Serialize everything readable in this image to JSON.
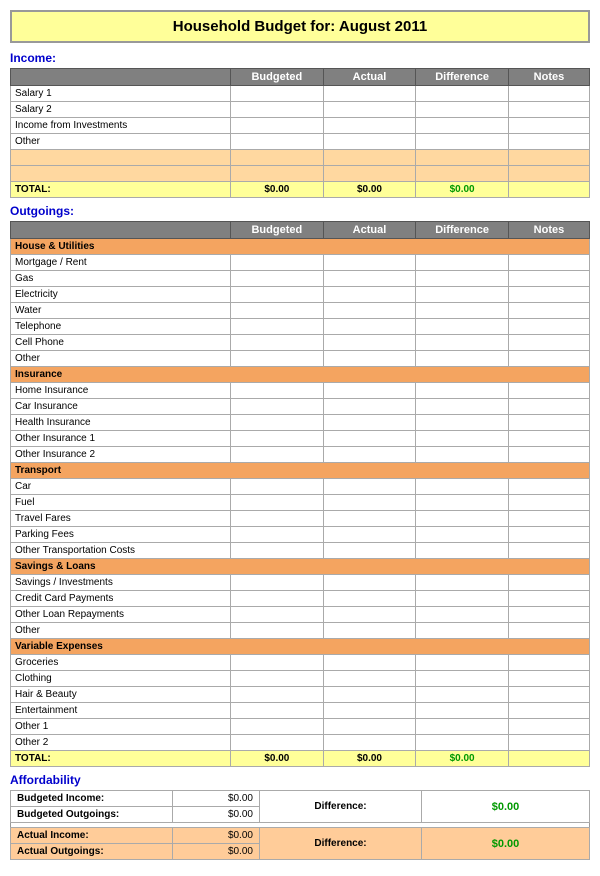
{
  "title": {
    "prefix": "Household Budget for:",
    "month": "August 2011",
    "full": "Household Budget for:   August 2011"
  },
  "income": {
    "label": "Income:",
    "headers": [
      "",
      "Budgeted",
      "Actual",
      "Difference",
      "Notes"
    ],
    "rows": [
      {
        "label": "Salary 1",
        "type": "white"
      },
      {
        "label": "Salary 2",
        "type": "white"
      },
      {
        "label": "Income from Investments",
        "type": "white"
      },
      {
        "label": "Other",
        "type": "white"
      },
      {
        "label": "",
        "type": "orange"
      },
      {
        "label": "",
        "type": "orange"
      }
    ],
    "total": {
      "label": "TOTAL:",
      "budgeted": "$0.00",
      "actual": "$0.00",
      "diff": "$0.00"
    }
  },
  "outgoings": {
    "label": "Outgoings:",
    "headers": [
      "",
      "Budgeted",
      "Actual",
      "Difference",
      "Notes"
    ],
    "sections": [
      {
        "header": "House & Utilities",
        "rows": [
          {
            "label": "Mortgage / Rent"
          },
          {
            "label": "Gas"
          },
          {
            "label": "Electricity"
          },
          {
            "label": "Water"
          },
          {
            "label": "Telephone"
          },
          {
            "label": "Cell Phone"
          },
          {
            "label": "Other"
          }
        ]
      },
      {
        "header": "Insurance",
        "rows": [
          {
            "label": "Home Insurance"
          },
          {
            "label": "Car Insurance"
          },
          {
            "label": "Health Insurance"
          },
          {
            "label": "Other Insurance 1"
          },
          {
            "label": "Other Insurance 2"
          }
        ]
      },
      {
        "header": "Transport",
        "rows": [
          {
            "label": "Car"
          },
          {
            "label": "Fuel"
          },
          {
            "label": "Travel Fares"
          },
          {
            "label": "Parking Fees"
          },
          {
            "label": "Other Transportation Costs"
          }
        ]
      },
      {
        "header": "Savings & Loans",
        "rows": [
          {
            "label": "Savings / Investments"
          },
          {
            "label": "Credit Card Payments"
          },
          {
            "label": "Other Loan Repayments"
          },
          {
            "label": "Other"
          }
        ]
      },
      {
        "header": "Variable Expenses",
        "rows": [
          {
            "label": "Groceries"
          },
          {
            "label": "Clothing"
          },
          {
            "label": "Hair & Beauty"
          },
          {
            "label": "Entertainment"
          },
          {
            "label": "Other 1"
          },
          {
            "label": "Other 2"
          }
        ]
      }
    ],
    "total": {
      "label": "TOTAL:",
      "budgeted": "$0.00",
      "actual": "$0.00",
      "diff": "$0.00"
    }
  },
  "affordability": {
    "label": "Affordability",
    "budgeted_income_label": "Budgeted Income:",
    "budgeted_income_val": "$0.00",
    "budgeted_outgoings_label": "Budgeted Outgoings:",
    "budgeted_outgoings_val": "$0.00",
    "budgeted_diff_label": "Difference:",
    "budgeted_diff_val": "$0.00",
    "actual_income_label": "Actual Income:",
    "actual_income_val": "$0.00",
    "actual_outgoings_label": "Actual Outgoings:",
    "actual_outgoings_val": "$0.00",
    "actual_diff_label": "Difference:",
    "actual_diff_val": "$0.00"
  }
}
